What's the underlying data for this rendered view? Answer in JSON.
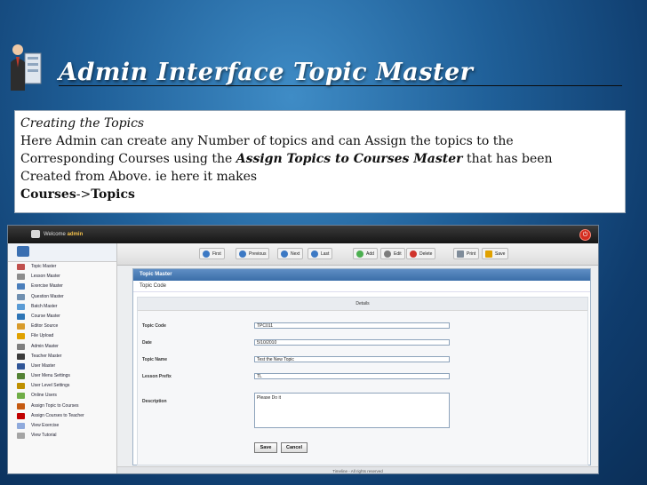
{
  "slide": {
    "title": "Admin Interface   Topic Master",
    "text": {
      "line1": "Creating the Topics",
      "line2": "Here Admin  can create any Number of topics and can Assign the topics to the",
      "line3a": "Corresponding Courses  using the ",
      "line3b": "Assign Topics to Courses Master",
      "line3c": "  that has been",
      "line4": "Created from Above. ie here it makes",
      "line5a": "Courses",
      "line5b": "->",
      "line5c": "Topics"
    }
  },
  "app": {
    "welcome": "Welcome",
    "user": "admin",
    "sidebar": {
      "items": [
        {
          "label": "Topic Master",
          "icon": "topic-icon",
          "color": "#c0504d"
        },
        {
          "label": "Lesson Master",
          "icon": "lesson-icon",
          "color": "#8c8c8c"
        },
        {
          "label": "Exercise Master",
          "icon": "exercise-icon",
          "color": "#4a7ebb"
        },
        {
          "label": "Question Master",
          "icon": "question-icon",
          "color": "#6f8fb0"
        },
        {
          "label": "Batch Master",
          "icon": "batch-icon",
          "color": "#5a9bd5"
        },
        {
          "label": "Course Master",
          "icon": "course-icon",
          "color": "#2e75b6"
        },
        {
          "label": "Editor Source",
          "icon": "editor-icon",
          "color": "#d89b2b"
        },
        {
          "label": "File Upload",
          "icon": "upload-icon",
          "color": "#e0a100"
        },
        {
          "label": "Admin Master",
          "icon": "admin-icon",
          "color": "#7f7f7f"
        },
        {
          "label": "Teacher Master",
          "icon": "teacher-icon",
          "color": "#3b3b3b"
        },
        {
          "label": "User Master",
          "icon": "user-icon",
          "color": "#2f5597"
        },
        {
          "label": "User Menu Settings",
          "icon": "settings-icon",
          "color": "#548235"
        },
        {
          "label": "User Level Settings",
          "icon": "level-icon",
          "color": "#bf9000"
        },
        {
          "label": "Online Users",
          "icon": "online-icon",
          "color": "#70ad47"
        },
        {
          "label": "Assign Topic to Courses",
          "icon": "assign-topic-icon",
          "color": "#c55a11"
        },
        {
          "label": "Assign Courses to Teacher",
          "icon": "assign-course-icon",
          "color": "#c00000"
        },
        {
          "label": "View Exercise",
          "icon": "view-exercise-icon",
          "color": "#8faadc"
        },
        {
          "label": "View Tutorial",
          "icon": "view-tutorial-icon",
          "color": "#a5a5a5"
        }
      ]
    },
    "toolbar": {
      "first": "First",
      "previous": "Previous",
      "next": "Next",
      "last": "Last",
      "add": "Add",
      "edit": "Edit",
      "delete": "Delete",
      "print": "Print",
      "save": "Save"
    },
    "panel": {
      "title": "Topic Master",
      "subtitle": "Topic Code",
      "details": "Details",
      "fields": {
        "topic_code": {
          "label": "Topic Code",
          "value": "TPC011"
        },
        "date": {
          "label": "Date",
          "value": "5/10/2010"
        },
        "topic_name": {
          "label": "Topic Name",
          "value": "Test the New Topic"
        },
        "lesson_prefix": {
          "label": "Lesson Prefix",
          "value": "TL"
        },
        "description": {
          "label": "Description",
          "value": "Please Do it"
        }
      },
      "save_button": "Save",
      "cancel_button": "Cancel"
    },
    "footer": "Timeline - All rights reserved"
  }
}
